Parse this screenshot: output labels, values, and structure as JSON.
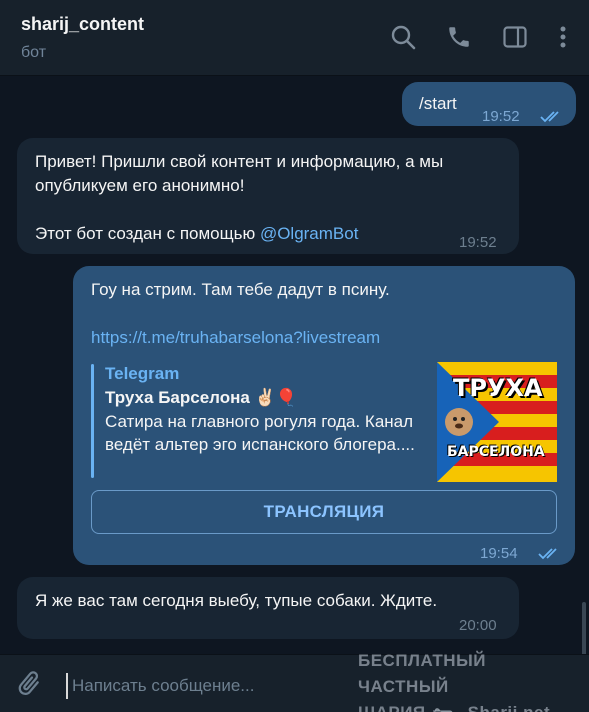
{
  "header": {
    "title": "sharij_content",
    "subtitle": "бот",
    "icons": [
      "search-icon",
      "phone-icon",
      "sidebar-toggle-icon",
      "more-vert-icon"
    ]
  },
  "messages": [
    {
      "direction": "out",
      "text": "/start",
      "time": "19:52",
      "status": "read"
    },
    {
      "direction": "in",
      "line1": "Привет! Пришли свой контент и информацию, а мы",
      "line2": "опубликуем его анонимно!",
      "line3_prefix": "Этот бот создан с помощью ",
      "line3_link": "@OlgramBot",
      "time": "19:52"
    },
    {
      "direction": "out",
      "text": "Гоу на стрим. Там тебе дадут в псину.",
      "link": "https://t.me/truhabarselona?livestream",
      "preview": {
        "site": "Telegram",
        "title": "Труха Барселона ✌🏻🎈",
        "description": "Сатира на главного рогуля года. Канал ведёт альтер эго испанского блогера....",
        "thumb_line1": "ТРУХА",
        "thumb_line2": "БАРСЕЛОНА"
      },
      "button": "ТРАНСЛЯЦИЯ",
      "time": "19:54",
      "status": "read"
    },
    {
      "direction": "in",
      "text": "Я же вас там сегодня выебу, тупые собаки. Ждите.",
      "time": "20:00"
    }
  ],
  "composer": {
    "placeholder": "Написать сообщение..."
  },
  "watermark": {
    "line1": "БЕСПЛАТНЫЙ ЧАСТНЫЙ",
    "line2a": "ШАРИЯ",
    "line2b": "Sharij.net"
  },
  "colors": {
    "background": "#0e1621",
    "header": "#17212b",
    "bubble_out": "#2b5278",
    "bubble_in": "#182533",
    "accent": "#6ab3f3"
  }
}
